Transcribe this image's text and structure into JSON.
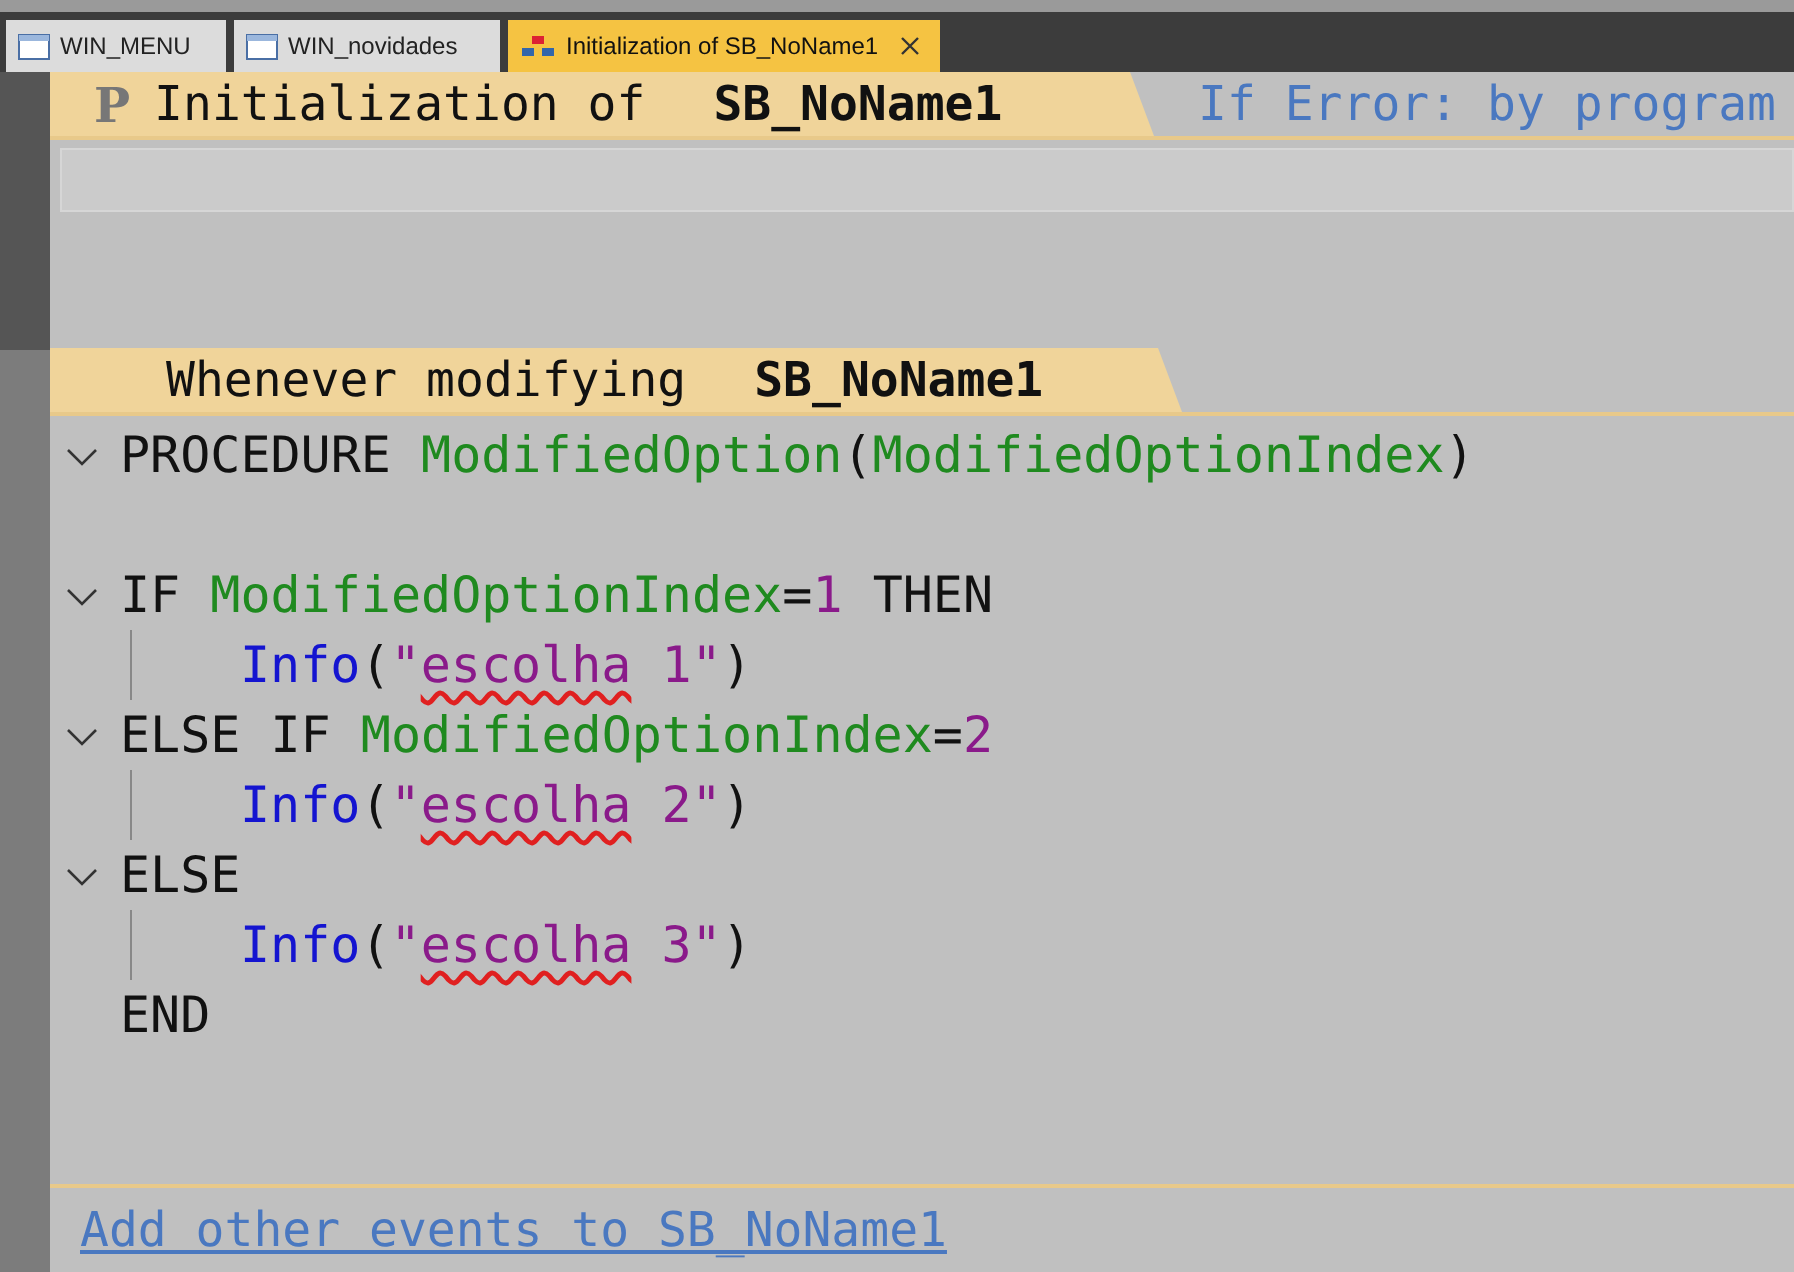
{
  "tabs": [
    {
      "label": "WIN_MENU",
      "kind": "window",
      "selected": false
    },
    {
      "label": "WIN_novidades",
      "kind": "window",
      "selected": false
    },
    {
      "label": "Initialization of SB_NoName1",
      "kind": "code",
      "selected": true,
      "closable": true
    }
  ],
  "header": {
    "mark": "P",
    "prefix": "Initialization of",
    "name": "SB_NoName1",
    "error_mode": "If Error: by program"
  },
  "event": {
    "prefix": "Whenever modifying",
    "name": "SB_NoName1"
  },
  "code_lines": [
    {
      "expanded": true,
      "tokens": [
        {
          "kind": "keyword",
          "text": "PROCEDURE "
        },
        {
          "kind": "ident",
          "text": "ModifiedOption"
        },
        {
          "kind": "punct",
          "text": "("
        },
        {
          "kind": "ident",
          "text": "ModifiedOptionIndex"
        },
        {
          "kind": "punct",
          "text": ")"
        }
      ]
    },
    {
      "blank": true
    },
    {
      "expanded": true,
      "tokens": [
        {
          "kind": "keyword",
          "text": "IF "
        },
        {
          "kind": "ident",
          "text": "ModifiedOptionIndex"
        },
        {
          "kind": "punct",
          "text": "="
        },
        {
          "kind": "number",
          "text": "1"
        },
        {
          "kind": "keyword",
          "text": " THEN"
        }
      ],
      "children": [
        {
          "tokens": [
            {
              "kind": "func",
              "text": "Info"
            },
            {
              "kind": "punct",
              "text": "("
            },
            {
              "kind": "string",
              "text": "\""
            },
            {
              "kind": "string",
              "text": "escolha",
              "misspelled": true
            },
            {
              "kind": "string",
              "text": " 1\""
            },
            {
              "kind": "punct",
              "text": ")"
            }
          ]
        }
      ]
    },
    {
      "expanded": true,
      "tokens": [
        {
          "kind": "keyword",
          "text": "ELSE IF "
        },
        {
          "kind": "ident",
          "text": "ModifiedOptionIndex"
        },
        {
          "kind": "punct",
          "text": "="
        },
        {
          "kind": "number",
          "text": "2"
        }
      ],
      "children": [
        {
          "tokens": [
            {
              "kind": "func",
              "text": "Info"
            },
            {
              "kind": "punct",
              "text": "("
            },
            {
              "kind": "string",
              "text": "\""
            },
            {
              "kind": "string",
              "text": "escolha",
              "misspelled": true
            },
            {
              "kind": "string",
              "text": " 2\""
            },
            {
              "kind": "punct",
              "text": ")"
            }
          ]
        }
      ]
    },
    {
      "expanded": true,
      "tokens": [
        {
          "kind": "keyword",
          "text": "ELSE"
        }
      ],
      "children": [
        {
          "tokens": [
            {
              "kind": "func",
              "text": "Info"
            },
            {
              "kind": "punct",
              "text": "("
            },
            {
              "kind": "string",
              "text": "\""
            },
            {
              "kind": "string",
              "text": "escolha",
              "misspelled": true
            },
            {
              "kind": "string",
              "text": " 3\""
            },
            {
              "kind": "punct",
              "text": ")"
            }
          ]
        }
      ]
    },
    {
      "tokens": [
        {
          "kind": "keyword",
          "text": "END"
        }
      ]
    }
  ],
  "add_events_link": "Add other events to SB_NoName1"
}
